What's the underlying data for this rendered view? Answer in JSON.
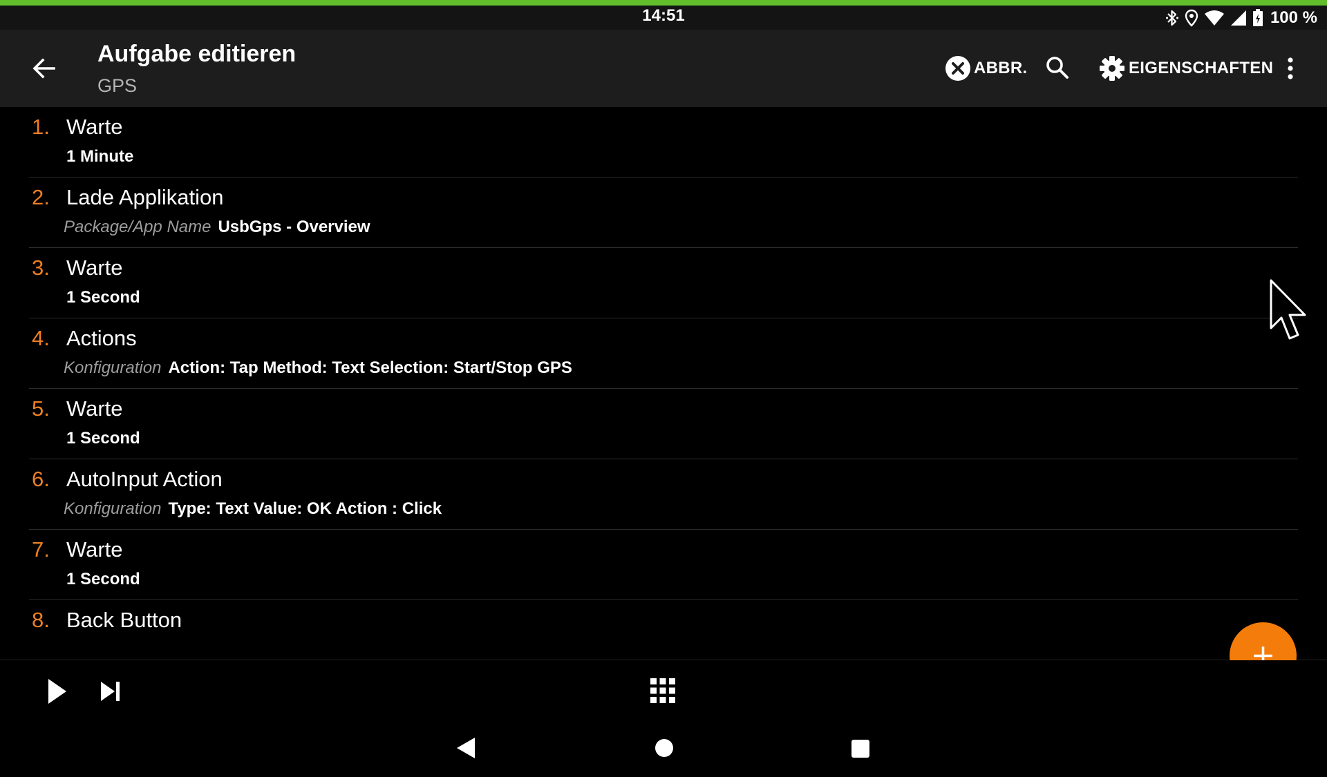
{
  "colors": {
    "accent_line": "#63be2e",
    "number_color": "#ee7f23",
    "fab": "#f47c0a",
    "app_bar": "#1d1d1d",
    "background": "#000000"
  },
  "status_bar": {
    "time": "14:51",
    "battery": "100 %",
    "icons": [
      "bluetooth-icon",
      "location-icon",
      "wifi-icon",
      "signal-icon",
      "battery-icon"
    ]
  },
  "app_bar": {
    "title": "Aufgabe editieren",
    "subtitle": "GPS",
    "cancel_label": "ABBR.",
    "properties_label": "EIGENSCHAFTEN"
  },
  "actions": [
    {
      "number": "1.",
      "name": "Warte",
      "label": "",
      "value": "1 Minute"
    },
    {
      "number": "2.",
      "name": "Lade Applikation",
      "label": "Package/App Name",
      "value": "UsbGps - Overview"
    },
    {
      "number": "3.",
      "name": "Warte",
      "label": "",
      "value": "1 Second"
    },
    {
      "number": "4.",
      "name": "Actions",
      "label": "Konfiguration",
      "value": "Action: Tap Method: Text Selection: Start/Stop GPS"
    },
    {
      "number": "5.",
      "name": "Warte",
      "label": "",
      "value": "1 Second"
    },
    {
      "number": "6.",
      "name": "AutoInput Action",
      "label": "Konfiguration",
      "value": "Type: Text Value: OK Action : Click"
    },
    {
      "number": "7.",
      "name": "Warte",
      "label": "",
      "value": "1 Second"
    },
    {
      "number": "8.",
      "name": "Back Button",
      "label": "",
      "value": ""
    }
  ],
  "toolbar": {
    "icons": [
      "play-icon",
      "step-forward-icon",
      "grid-icon"
    ]
  },
  "nav_bar": {
    "icons": [
      "nav-back-icon",
      "nav-home-icon",
      "nav-recents-icon"
    ]
  }
}
